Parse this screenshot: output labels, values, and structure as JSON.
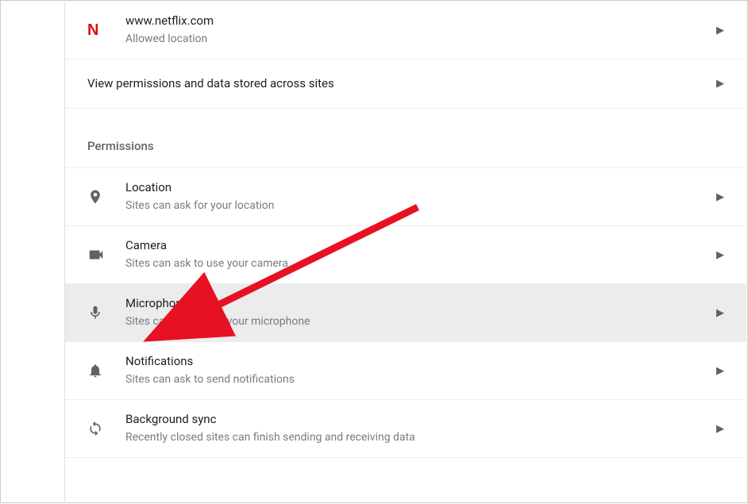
{
  "recent_site": {
    "icon_letter": "N",
    "domain": "www.netflix.com",
    "status": "Allowed location"
  },
  "view_all_row": {
    "label": "View permissions and data stored across sites"
  },
  "permissions_header": "Permissions",
  "permissions": [
    {
      "icon": "location",
      "title": "Location",
      "subtitle": "Sites can ask for your location",
      "highlight": false
    },
    {
      "icon": "camera",
      "title": "Camera",
      "subtitle": "Sites can ask to use your camera",
      "highlight": false
    },
    {
      "icon": "microphone",
      "title": "Microphone",
      "subtitle": "Sites can ask to use your microphone",
      "highlight": true
    },
    {
      "icon": "notifications",
      "title": "Notifications",
      "subtitle": "Sites can ask to send notifications",
      "highlight": false
    },
    {
      "icon": "sync",
      "title": "Background sync",
      "subtitle": "Recently closed sites can finish sending and receiving data",
      "highlight": false
    }
  ],
  "annotation": {
    "arrow_color": "#e81123"
  }
}
